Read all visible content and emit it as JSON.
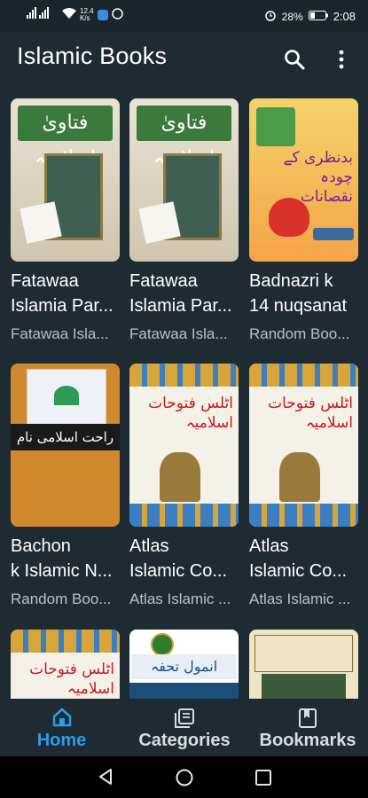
{
  "status": {
    "speed": "12.4\nK/s",
    "battery": "28%",
    "time": "2:08"
  },
  "app": {
    "title": "Islamic Books"
  },
  "books": [
    {
      "title_line1": "Fatawaa",
      "title_line2": "Islamia Par...",
      "subtitle": "Fatawaa Isla...",
      "cover_text": "فتاویٰ اسلامیہ"
    },
    {
      "title_line1": "Fatawaa",
      "title_line2": "Islamia Par...",
      "subtitle": "Fatawaa Isla...",
      "cover_text": "فتاویٰ اسلامیہ"
    },
    {
      "title_line1": "Badnazri k",
      "title_line2": "14 nuqsanat",
      "subtitle": "Random Boo...",
      "cover_text": "بدنظری کے چودہ نقصانات"
    },
    {
      "title_line1": "Bachon",
      "title_line2": "k Islamic N...",
      "subtitle": "Random Boo...",
      "cover_text": "راحت اسلامی نام"
    },
    {
      "title_line1": "Atlas",
      "title_line2": "Islamic Co...",
      "subtitle": "Atlas Islamic ...",
      "cover_text": "اٹلس فتوحات اسلامیہ"
    },
    {
      "title_line1": "Atlas",
      "title_line2": "Islamic Co...",
      "subtitle": "Atlas Islamic ...",
      "cover_text": "اٹلس فتوحات اسلامیہ"
    },
    {
      "cover_text": "اٹلس فتوحات اسلامیہ"
    },
    {
      "cover_text": "انمول تحفہ"
    },
    {
      "cover_text": ""
    }
  ],
  "nav": {
    "home": "Home",
    "categories": "Categories",
    "bookmarks": "Bookmarks",
    "active_color": "#2e9be6",
    "inactive_color": "#d9dde0"
  }
}
